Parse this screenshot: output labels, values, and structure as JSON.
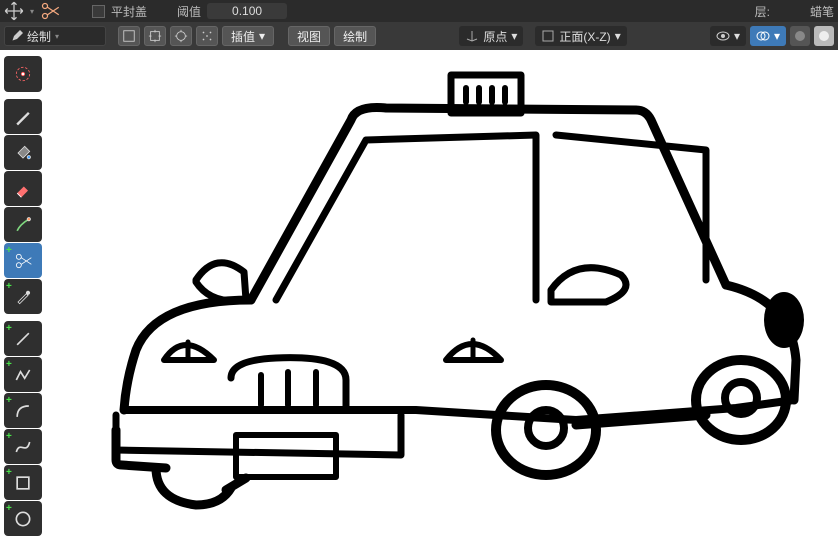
{
  "top1": {
    "flat_label": "平封盖",
    "threshold_label": "阈值",
    "threshold_value": "0.100",
    "layer_label": "层:",
    "brush_label": "蜡笔"
  },
  "top2": {
    "mode_dropdown": "绘制",
    "insert_btn": "插值",
    "view_btn": "视图",
    "draw_btn": "绘制",
    "origin_dropdown": "原点",
    "orient_dropdown": "正面(X-Z)"
  },
  "tools": {
    "cursor": "cursor",
    "draw": "draw",
    "fill": "fill",
    "erase": "erase",
    "tint": "tint",
    "cutter": "cutter",
    "eyedrop": "eyedrop",
    "line": "line",
    "polyline": "polyline",
    "arc": "arc",
    "curve": "curve",
    "box": "box",
    "circle": "circle"
  }
}
